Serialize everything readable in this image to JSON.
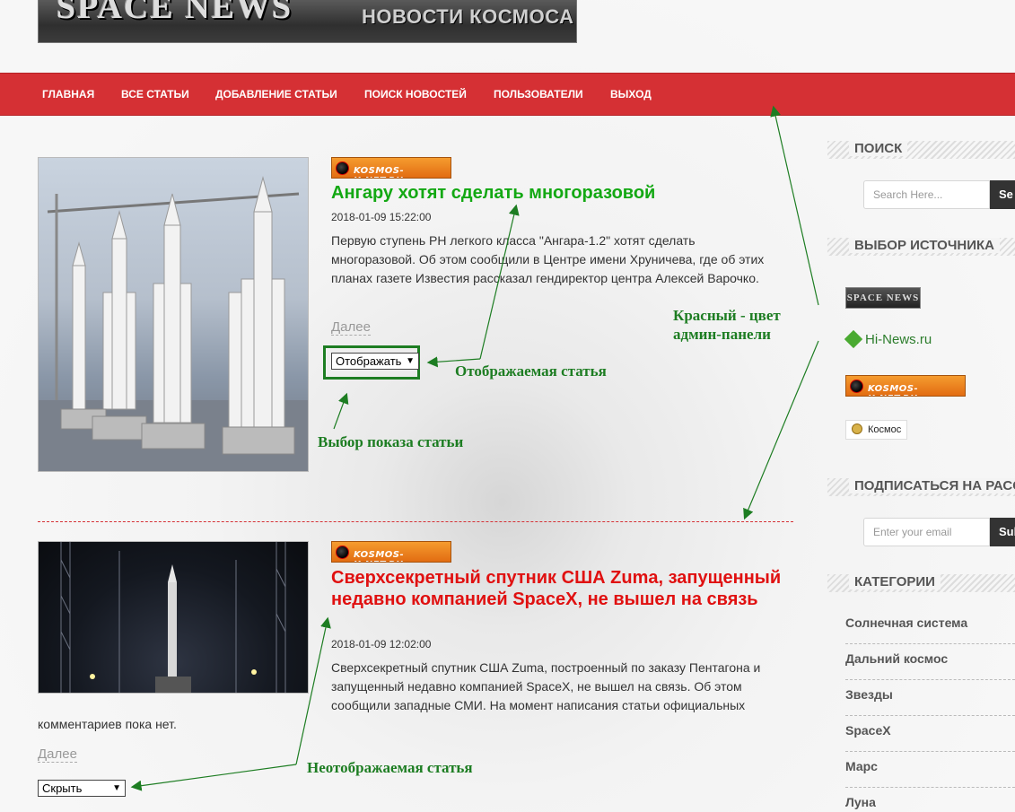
{
  "header": {
    "logo_text": "SPACE NEWS",
    "subtitle": "НОВОСТИ КОСМОСА"
  },
  "nav": {
    "items": [
      {
        "label": "ГЛАВНАЯ"
      },
      {
        "label": "ВСЕ СТАТЬИ"
      },
      {
        "label": "ДОБАВЛЕНИЕ СТАТЬИ"
      },
      {
        "label": "ПОИСК НОВОСТЕЙ"
      },
      {
        "label": "ПОЛЬЗОВАТЕЛИ"
      },
      {
        "label": "ВЫХОД"
      }
    ],
    "color": "#d53034"
  },
  "articles": [
    {
      "source_badge": "KOSMOS-X.NET.RU",
      "title": "Ангару хотят сделать многоразовой",
      "title_color": "#13a813",
      "date": "2018-01-09 15:22:00",
      "excerpt": "Первую ступень РН легкого класса \"Ангара-1.2\" хотят сделать многоразовой. Об этом сообщили в Центре имени Хруничева, где об этих планах газете Известия рассказал гендиректор центра Алексей Варочко.",
      "more_label": "Далее",
      "visibility": "Отображать"
    },
    {
      "source_badge": "KOSMOS-X.NET.RU",
      "title": "Сверхсекретный спутник США Zuma, запущенный недавно компанией SpaceX, не вышел на связь",
      "title_color": "#e01010",
      "date": "2018-01-09 12:02:00",
      "excerpt": "Сверхсекретный спутник США Zuma, построенный по заказу Пентагона и запущенный недавно компанией SpaceX, не вышел на связь. Об этом сообщили западные СМИ. На момент написания статьи официальных",
      "excerpt_tail": "комментариев пока нет.",
      "more_label": "Далее",
      "visibility": "Скрыть"
    }
  ],
  "annotations": {
    "red_color_line1": "Красный - цвет",
    "red_color_line2": "админ-панели",
    "displayed_article": "Отображаемая статья",
    "choose_visibility": "Выбор показа статьи",
    "hidden_article": "Неотображаемая статья"
  },
  "sidebar": {
    "search": {
      "heading": "ПОИСК",
      "placeholder": "Search Here...",
      "button_label": "Se"
    },
    "sources": {
      "heading": "ВЫБОР ИСТОЧНИКА",
      "items": [
        {
          "label": "SPACE NEWS"
        },
        {
          "label": "Hi-News.ru"
        },
        {
          "label": "KOSMOS-X.NET.RU"
        },
        {
          "label": "Космос"
        }
      ]
    },
    "subscribe": {
      "heading": "ПОДПИСАТЬСЯ НА РАСС",
      "placeholder": "Enter your email",
      "button_label": "Sub"
    },
    "categories": {
      "heading": "КАТЕГОРИИ",
      "items": [
        {
          "label": "Солнечная система"
        },
        {
          "label": "Дальний космос"
        },
        {
          "label": "Звезды"
        },
        {
          "label": "SpaceX"
        },
        {
          "label": "Марс"
        },
        {
          "label": "Луна"
        }
      ]
    }
  }
}
